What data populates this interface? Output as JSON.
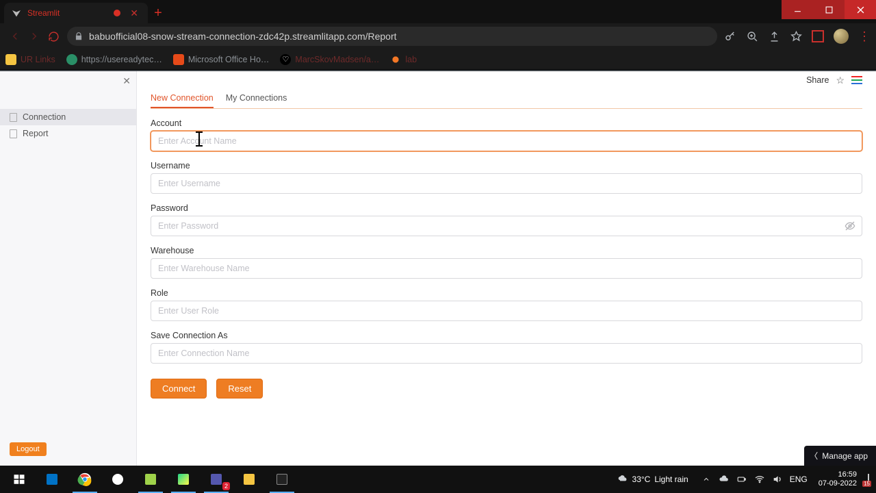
{
  "browser": {
    "tab_title": "Streamlit",
    "url": "babuofficial08-snow-stream-connection-zdc42p.streamlitapp.com/Report",
    "bookmarks": [
      {
        "label": "UR Links"
      },
      {
        "label": "https://usereadytec…"
      },
      {
        "label": "Microsoft Office Ho…"
      },
      {
        "label": "MarcSkovMadsen/a…"
      },
      {
        "label": "lab"
      }
    ]
  },
  "app": {
    "sidebar": {
      "items": [
        {
          "label": "Connection"
        },
        {
          "label": "Report"
        }
      ],
      "logout_label": "Logout"
    },
    "header": {
      "share_label": "Share"
    },
    "tabs": {
      "new_connection": "New Connection",
      "my_connections": "My Connections"
    },
    "form": {
      "account_label": "Account",
      "account_placeholder": "Enter Account Name",
      "username_label": "Username",
      "username_placeholder": "Enter Username",
      "password_label": "Password",
      "password_placeholder": "Enter Password",
      "warehouse_label": "Warehouse",
      "warehouse_placeholder": "Enter Warehouse Name",
      "role_label": "Role",
      "role_placeholder": "Enter User Role",
      "save_as_label": "Save Connection As",
      "save_as_placeholder": "Enter Connection Name",
      "connect_label": "Connect",
      "reset_label": "Reset"
    },
    "manage_app_label": "Manage app"
  },
  "taskbar": {
    "weather_temp": "33°C",
    "weather_desc": "Light rain",
    "lang": "ENG",
    "time": "16:59",
    "date": "07-09-2022",
    "notif_count": "15",
    "teams_badge": "2"
  }
}
